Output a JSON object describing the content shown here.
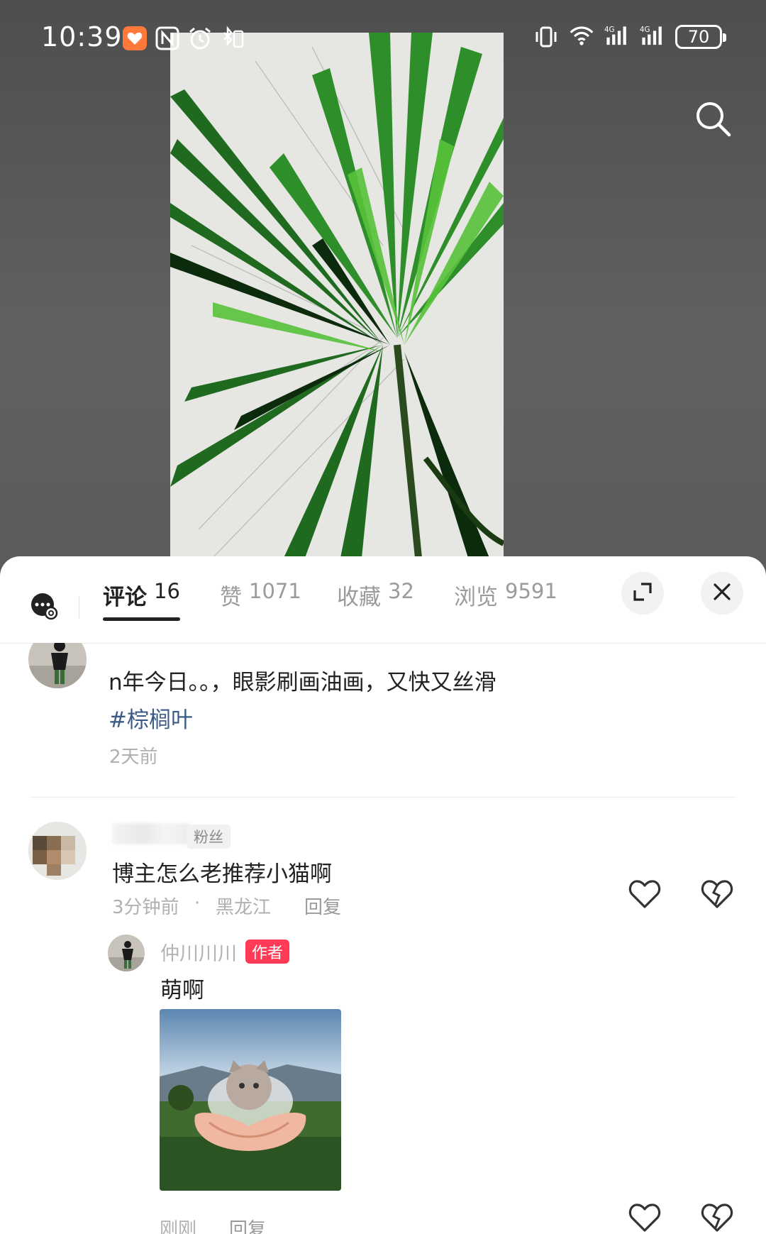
{
  "status_bar": {
    "time": "10:39",
    "battery": "70"
  },
  "tabs": [
    {
      "label": "评论",
      "count": "16",
      "active": true
    },
    {
      "label": "赞",
      "count": "1071",
      "active": false
    },
    {
      "label": "收藏",
      "count": "32",
      "active": false
    },
    {
      "label": "浏览",
      "count": "9591",
      "active": false
    }
  ],
  "post": {
    "text": "n年今日。。，眼影刷画油画，又快又丝滑",
    "hashtag": "#棕榈叶",
    "time": "2天前"
  },
  "comment": {
    "badge": "粉丝",
    "text": "博主怎么老推荐小猫啊",
    "time": "3分钟前",
    "dot": "·",
    "location": "黑龙江",
    "reply_label": "回复"
  },
  "reply": {
    "username": "仲川川川",
    "badge": "作者",
    "text": "萌啊",
    "time": "刚刚",
    "reply_label": "回复"
  },
  "icons": {
    "search": "search-icon",
    "chat": "chat-settings-icon",
    "expand": "expand-icon",
    "close": "close-icon",
    "like": "heart-icon",
    "dislike": "broken-heart-icon"
  },
  "colors": {
    "author_badge": "#ff3b57",
    "hashtag": "#3b5a86",
    "active_tab": "#222222"
  }
}
